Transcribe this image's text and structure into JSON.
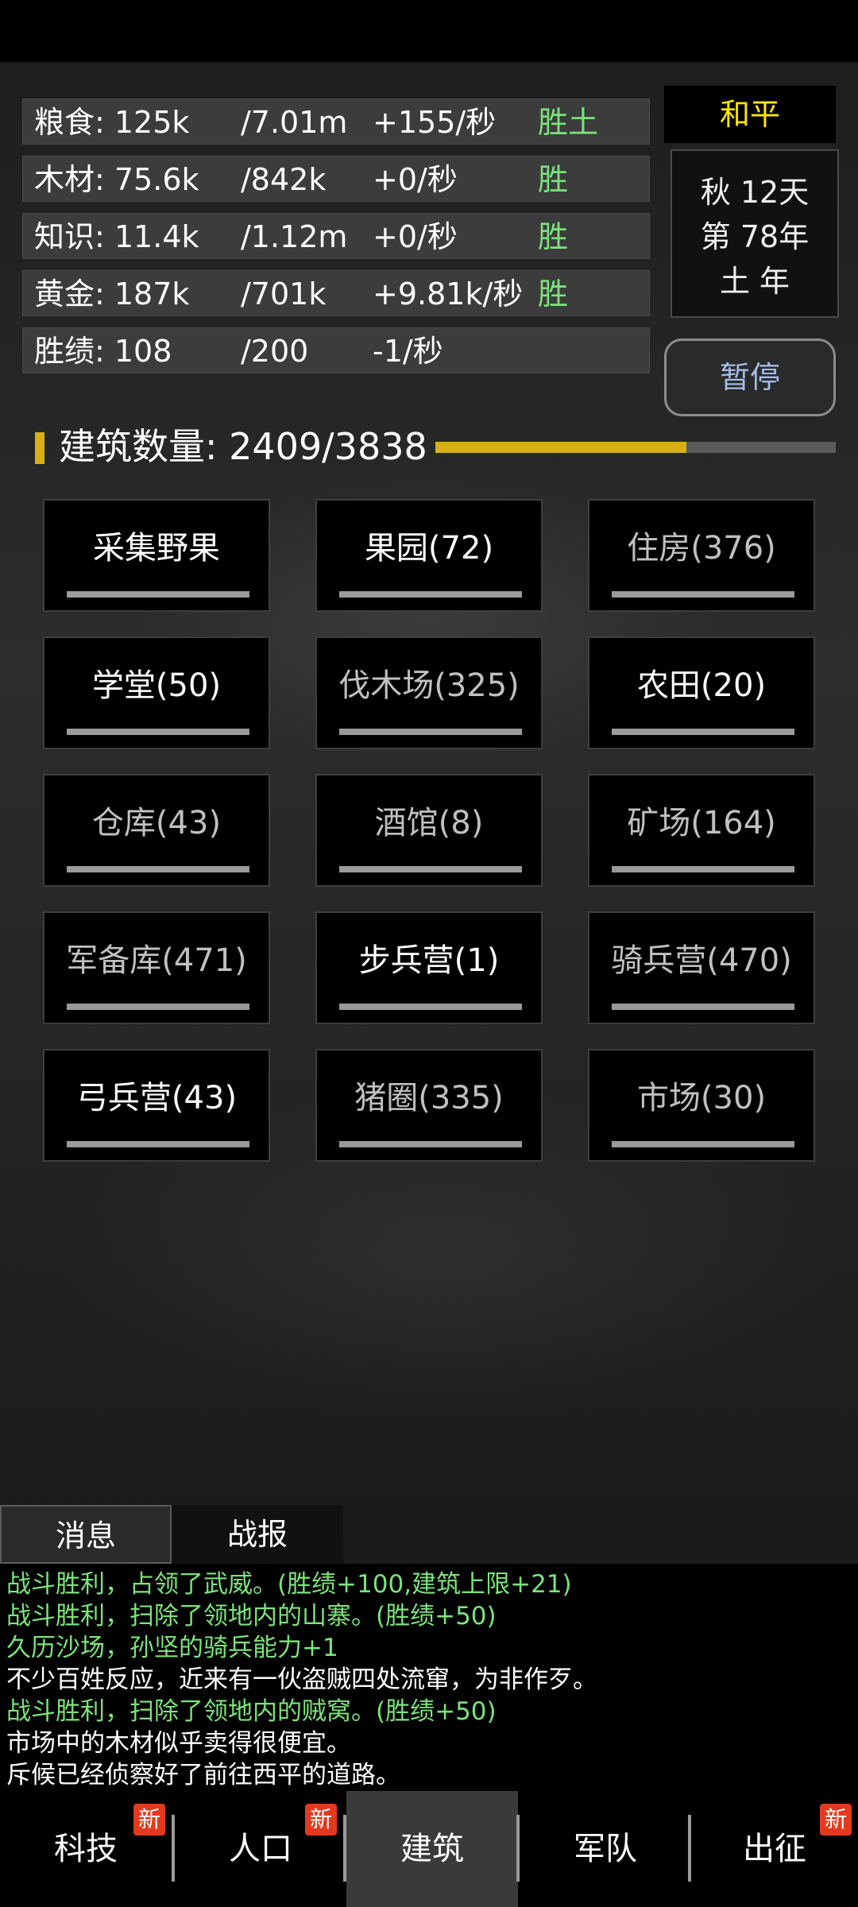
{
  "resources": [
    {
      "name": "粮食: 125k",
      "cap": "/7.01m",
      "rate": "+155/秒",
      "tag": "胜土"
    },
    {
      "name": "木材: 75.6k",
      "cap": "/842k",
      "rate": "+0/秒",
      "tag": "胜"
    },
    {
      "name": "知识: 11.4k",
      "cap": "/1.12m",
      "rate": "+0/秒",
      "tag": "胜"
    },
    {
      "name": "黄金: 187k",
      "cap": "/701k",
      "rate": "+9.81k/秒",
      "tag": "胜"
    },
    {
      "name": "胜绩: 108",
      "cap": "/200",
      "rate": "-1/秒",
      "tag": ""
    }
  ],
  "status": {
    "peace": "和平",
    "season": "秋 12天",
    "year": "第 78年",
    "year_type": "土 年",
    "pause": "暂停"
  },
  "buildings_count": {
    "label": "建筑数量: 2409/3838",
    "fraction": 0.6277
  },
  "buildings": [
    {
      "label": "采集野果",
      "dim": false
    },
    {
      "label": "果园(72)",
      "dim": false
    },
    {
      "label": "住房(376)",
      "dim": true
    },
    {
      "label": "学堂(50)",
      "dim": false
    },
    {
      "label": "伐木场(325)",
      "dim": true
    },
    {
      "label": "农田(20)",
      "dim": false
    },
    {
      "label": "仓库(43)",
      "dim": true
    },
    {
      "label": "酒馆(8)",
      "dim": true
    },
    {
      "label": "矿场(164)",
      "dim": true
    },
    {
      "label": "军备库(471)",
      "dim": true
    },
    {
      "label": "步兵营(1)",
      "dim": false
    },
    {
      "label": "骑兵营(470)",
      "dim": true
    },
    {
      "label": "弓兵营(43)",
      "dim": false
    },
    {
      "label": "猪圈(335)",
      "dim": true
    },
    {
      "label": "市场(30)",
      "dim": true
    }
  ],
  "log_tabs": [
    "消息",
    "战报"
  ],
  "log": [
    {
      "text": "战斗胜利，占领了武威。(胜绩+100,建筑上限+21)",
      "color": "green"
    },
    {
      "text": "战斗胜利，扫除了领地内的山寨。(胜绩+50)",
      "color": "green"
    },
    {
      "text": "久历沙场，孙坚的骑兵能力+1",
      "color": "green"
    },
    {
      "text": "不少百姓反应，近来有一伙盗贼四处流窜，为非作歹。",
      "color": "white"
    },
    {
      "text": "战斗胜利，扫除了领地内的贼窝。(胜绩+50)",
      "color": "green"
    },
    {
      "text": "市场中的木材似乎卖得很便宜。",
      "color": "white"
    },
    {
      "text": "斥候已经侦察好了前往西平的道路。",
      "color": "white"
    }
  ],
  "nav": [
    {
      "label": "科技",
      "badge": "新",
      "active": false
    },
    {
      "label": "人口",
      "badge": "新",
      "active": false
    },
    {
      "label": "建筑",
      "badge": "",
      "active": true
    },
    {
      "label": "军队",
      "badge": "",
      "active": false
    },
    {
      "label": "出征",
      "badge": "新",
      "active": false
    }
  ],
  "colors": {
    "gold": "#d6b016",
    "green": "#7be37b",
    "peace": "#ffe600",
    "badge": "#e33a1f"
  }
}
